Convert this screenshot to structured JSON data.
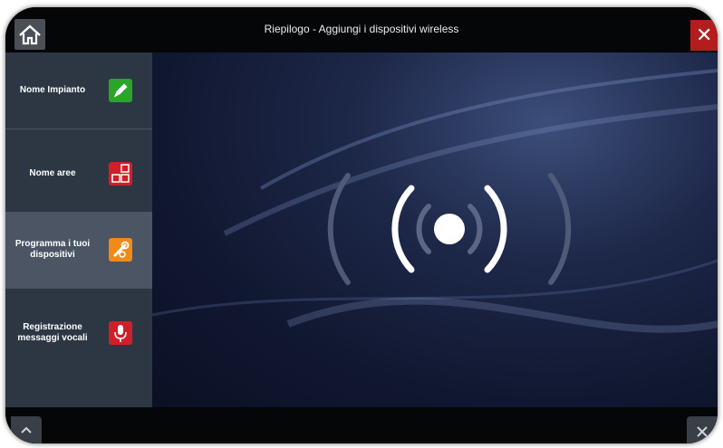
{
  "header": {
    "title": "Riepilogo - Aggiungi i dispositivi wireless",
    "home_icon": "home-icon",
    "close_icon": "close-icon"
  },
  "sidebar": {
    "items": [
      {
        "label": "Nome Impianto",
        "icon": "pencil-icon",
        "icon_color": "#2aa52a",
        "active": false
      },
      {
        "label": "Nome aree",
        "icon": "areas-grid-icon",
        "icon_color": "#d11f2a",
        "active": false
      },
      {
        "label": "Programma i tuoi dispositivi",
        "icon": "wrench-link-icon",
        "icon_color": "#f08a18",
        "active": true
      },
      {
        "label": "Registrazione messaggi vocali",
        "icon": "microphone-icon",
        "icon_color": "#d11f2a",
        "active": false
      }
    ],
    "scroll_up_icon": "chevron-up-icon",
    "scroll_down_icon": "chevron-down-icon"
  },
  "main": {
    "graphic": "wireless-signal-icon"
  },
  "colors": {
    "accent_red": "#b31d1d",
    "sidebar_bg": "#2d3744",
    "active_item_bg": "#4c5564"
  }
}
